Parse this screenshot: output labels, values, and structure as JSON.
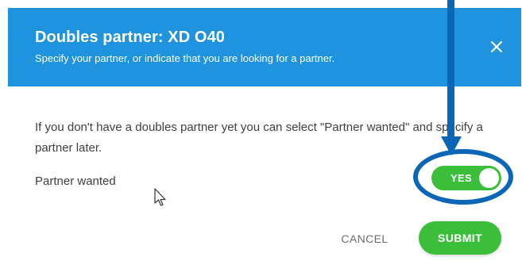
{
  "dialog": {
    "title": "Doubles partner: XD O40",
    "subtitle": "Specify your partner, or indicate that you are looking for a partner.",
    "close_icon": "close-icon",
    "body_text": "If you don't have a doubles partner yet you can select \"Partner wanted\" and specify a partner later.",
    "partner_wanted_label": "Partner wanted",
    "toggle": {
      "label": "YES",
      "checked": true
    },
    "cancel_label": "CANCEL",
    "submit_label": "SUBMIT"
  },
  "colors": {
    "header_bg": "#1f93de",
    "toggle_on": "#3bbf3b",
    "submit_bg": "#3bbf3b",
    "annotation": "#0b66b8"
  },
  "overlay": {
    "annotation_arrow_icon": "down-arrow-annotation",
    "annotation_circle_icon": "highlight-ellipse",
    "pointer_icon": "mouse-pointer-icon"
  }
}
